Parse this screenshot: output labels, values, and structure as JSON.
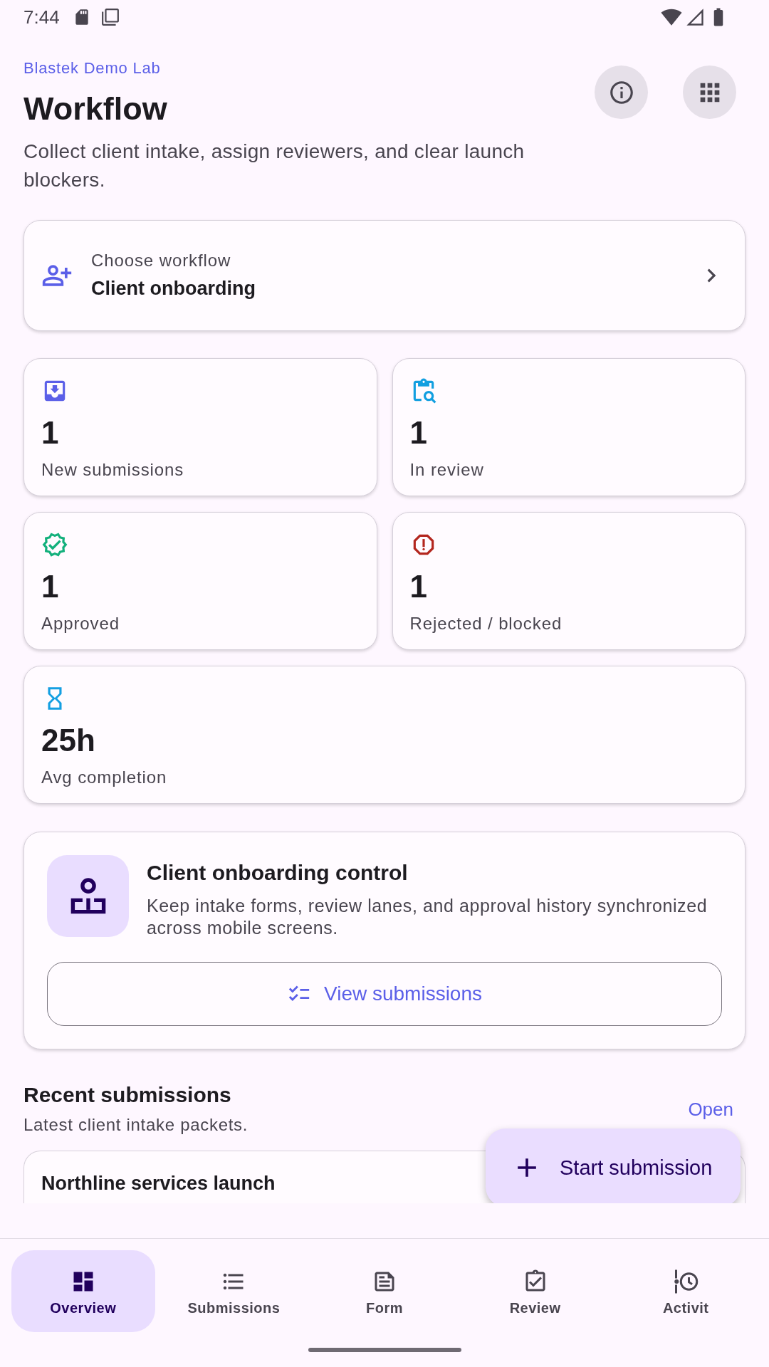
{
  "status_bar": {
    "time": "7:44"
  },
  "header": {
    "org": "Blastek Demo Lab",
    "title": "Workflow",
    "description": "Collect client intake, assign reviewers, and clear launch blockers."
  },
  "workflow_picker": {
    "label": "Choose workflow",
    "value": "Client onboarding"
  },
  "stats": [
    {
      "value": "1",
      "label": "New submissions",
      "color": "#5b5fe8"
    },
    {
      "value": "1",
      "label": "In review",
      "color": "#129fe0"
    },
    {
      "value": "1",
      "label": "Approved",
      "color": "#13b07c"
    },
    {
      "value": "1",
      "label": "Rejected / blocked",
      "color": "#b3261e"
    },
    {
      "value": "25h",
      "label": "Avg completion",
      "color": "#149fe2"
    }
  ],
  "control_card": {
    "title": "Client onboarding control",
    "description": "Keep intake forms, review lanes, and approval history synchronized across mobile screens.",
    "button": "View submissions"
  },
  "recent": {
    "title": "Recent submissions",
    "subtitle": "Latest client intake packets.",
    "action": "Open",
    "items": [
      {
        "title": "Northline services launch"
      }
    ]
  },
  "fab": {
    "label": "Start submission"
  },
  "bottom_nav": [
    {
      "label": "Overview",
      "selected": true
    },
    {
      "label": "Submissions",
      "selected": false
    },
    {
      "label": "Form",
      "selected": false
    },
    {
      "label": "Review",
      "selected": false
    },
    {
      "label": "Activit",
      "selected": false
    }
  ]
}
